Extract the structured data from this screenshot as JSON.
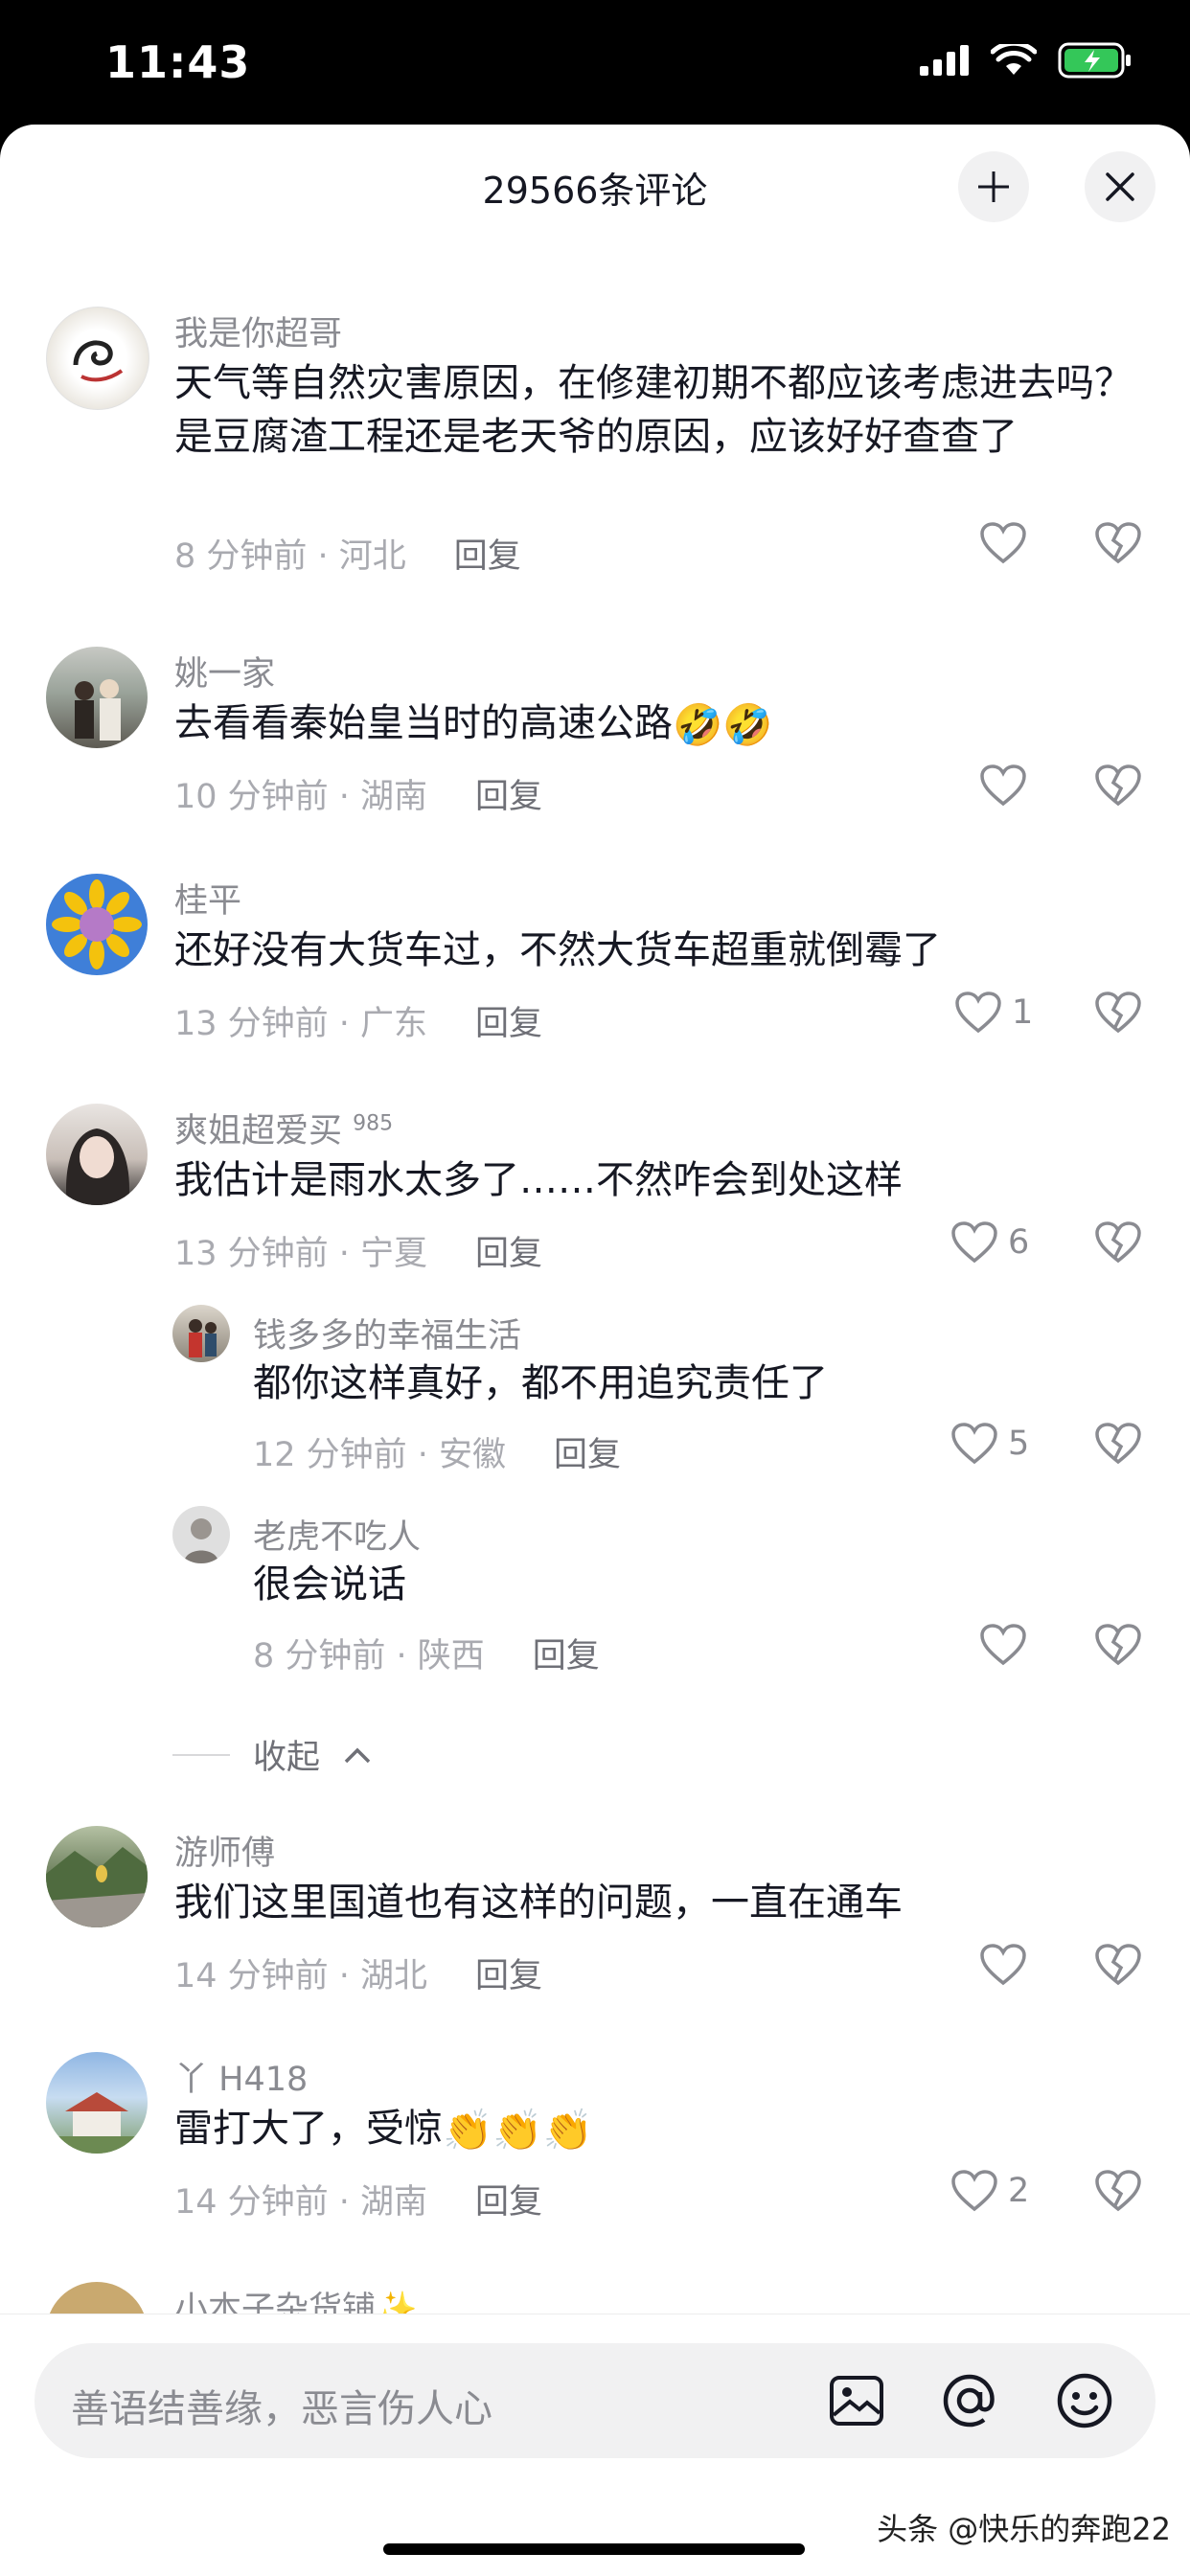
{
  "status": {
    "time": "11:43"
  },
  "header": {
    "title": "29566条评论"
  },
  "comments": [
    {
      "name": "我是你超哥",
      "text": "天气等自然灾害原因，在修建初期不都应该考虑进去吗？是豆腐渣工程还是老天爷的原因，应该好好查查了",
      "meta": "8 分钟前 · 河北",
      "reply": "回复",
      "likes": ""
    },
    {
      "name": "姚一家",
      "text": "去看看秦始皇当时的高速公路",
      "emoji": "🤣🤣",
      "meta": "10 分钟前 · 湖南",
      "reply": "回复",
      "likes": ""
    },
    {
      "name": "桂平",
      "text": "还好没有大货车过，不然大货车超重就倒霉了",
      "meta": "13 分钟前 · 广东",
      "reply": "回复",
      "likes": "1"
    },
    {
      "name": "爽姐超爱买",
      "badge": "985",
      "text": "我估计是雨水太多了……不然咋会到处这样",
      "meta": "13 分钟前 · 宁夏",
      "reply": "回复",
      "likes": "6"
    },
    {
      "name": "钱多多的幸福生活",
      "text": "都你这样真好，都不用追究责任了",
      "meta": "12 分钟前 · 安徽",
      "reply": "回复",
      "likes": "5"
    },
    {
      "name": "老虎不吃人",
      "text": "很会说话",
      "meta": "8 分钟前 · 陕西",
      "reply": "回复",
      "likes": ""
    },
    {
      "name": "游师傅",
      "text": "我们这里国道也有这样的问题，一直在通车",
      "meta": "14 分钟前 · 湖北",
      "reply": "回复",
      "likes": ""
    },
    {
      "name": "丫 H418",
      "text": "雷打大了，受惊",
      "emoji": "👏👏👏",
      "meta": "14 分钟前 · 湖南",
      "reply": "回复",
      "likes": "2"
    },
    {
      "name": "小本子杂货铺",
      "emoji": "✨"
    }
  ],
  "collapse_label": "收起",
  "input": {
    "placeholder": "善语结善缘，恶言伤人心"
  },
  "watermark": "头条 @快乐的奔跑22",
  "icons": [
    "signal-icon",
    "wifi-icon",
    "battery-icon",
    "minimize-icon",
    "close-icon",
    "heart-icon",
    "broken-heart-icon",
    "image-icon",
    "at-icon",
    "emoji-icon"
  ]
}
